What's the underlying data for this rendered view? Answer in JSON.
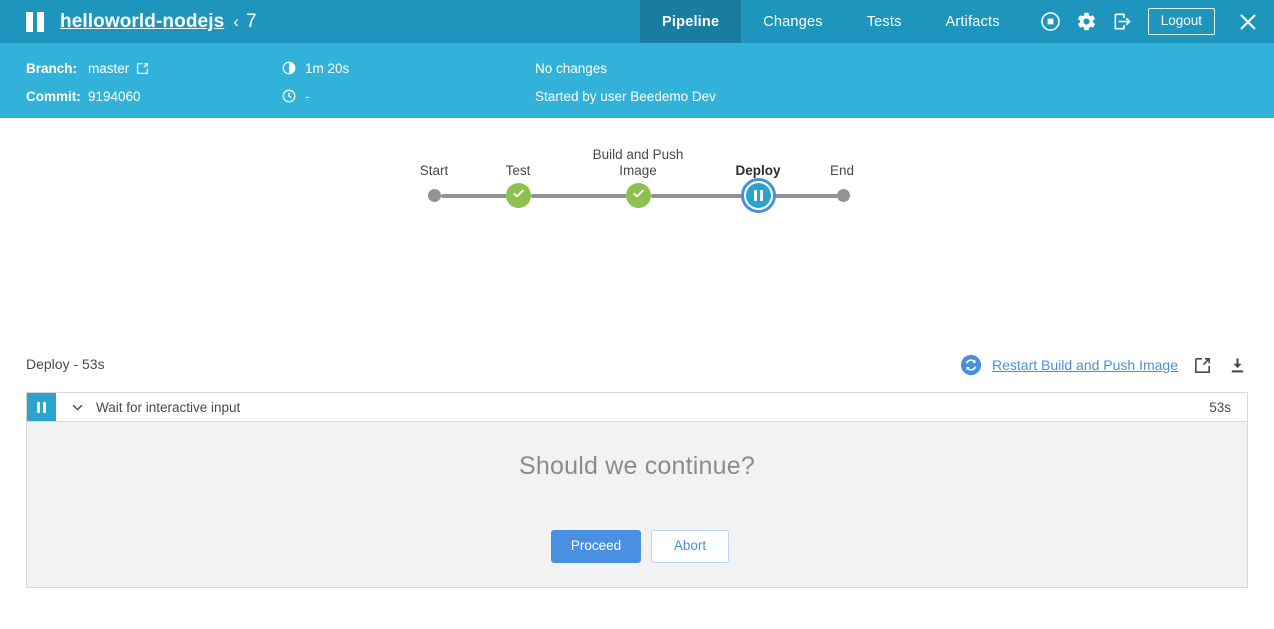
{
  "header": {
    "logo_icon": "pause-icon",
    "project_name": "helloworld-nodejs",
    "crumb_separator": "‹",
    "run_number": "7",
    "tabs": [
      {
        "label": "Pipeline",
        "active": true
      },
      {
        "label": "Changes",
        "active": false
      },
      {
        "label": "Tests",
        "active": false
      },
      {
        "label": "Artifacts",
        "active": false
      }
    ],
    "icons": [
      {
        "name": "stop-icon"
      },
      {
        "name": "gear-icon"
      },
      {
        "name": "login-icon"
      }
    ],
    "logout_label": "Logout",
    "close_label": "close-icon"
  },
  "meta": {
    "branch_label": "Branch:",
    "branch_value": "master",
    "branch_link_icon": "external-link-icon",
    "commit_label": "Commit:",
    "commit_value": "9194060",
    "duration_icon": "duration-icon",
    "duration_value": "1m 20s",
    "clock_icon": "clock-icon",
    "clock_value": "-",
    "changes_text": "No changes",
    "started_by_text": "Started by user Beedemo Dev"
  },
  "pipeline": {
    "nodes": [
      {
        "label": "Start",
        "state": "start",
        "selected": false
      },
      {
        "label": "Test",
        "state": "success",
        "selected": false
      },
      {
        "label": "Build and Push Image",
        "state": "success",
        "selected": false
      },
      {
        "label": "Deploy",
        "state": "paused",
        "selected": true
      },
      {
        "label": "End",
        "state": "end",
        "selected": false
      }
    ],
    "colors": {
      "success": "#8cc04f",
      "paused": "#2ba3cd",
      "idle": "#949393",
      "selection_ring": "#4a90d9"
    }
  },
  "results": {
    "title": "Deploy - 53s",
    "replay_icon": "replay-icon",
    "restart_link": "Restart Build and Push Image",
    "open_external_icon": "external-link-icon",
    "download_icon": "download-icon"
  },
  "step": {
    "status_icon": "pause-icon",
    "expand_icon": "chevron-down-icon",
    "title": "Wait for interactive input",
    "duration": "53s"
  },
  "input": {
    "question": "Should we continue?",
    "proceed_label": "Proceed",
    "abort_label": "Abort"
  },
  "colors": {
    "topbar": "#1d95bd",
    "topbar_active_tab": "#197da0",
    "metabar": "#32b2d8",
    "accent_blue": "#4a90e2",
    "panel_bg": "#f2f2f2"
  }
}
